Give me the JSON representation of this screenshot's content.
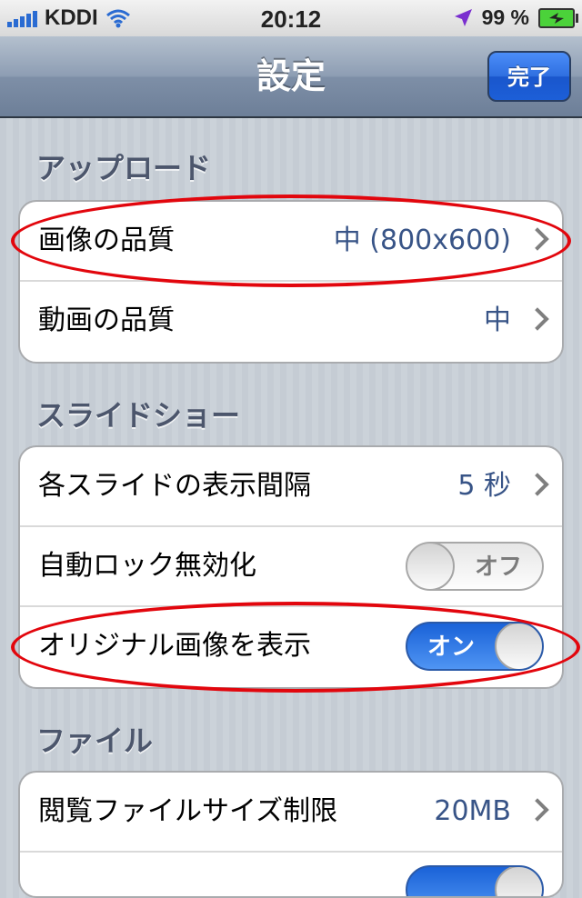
{
  "status_bar": {
    "carrier": "KDDI",
    "time": "20:12",
    "battery": "99 %",
    "battery_level": 0.99
  },
  "nav": {
    "title": "設定",
    "done_label": "完了"
  },
  "sections": [
    {
      "title": "アップロード",
      "rows": [
        {
          "label": "画像の品質",
          "value": "中 (800x600)"
        },
        {
          "label": "動画の品質",
          "value": "中"
        }
      ]
    },
    {
      "title": "スライドショー",
      "rows": [
        {
          "label": "各スライドの表示間隔",
          "value": "5 秒"
        },
        {
          "label": "自動ロック無効化",
          "toggle": "オフ"
        },
        {
          "label": "オリジナル画像を表示",
          "toggle": "オン"
        }
      ]
    },
    {
      "title": "ファイル",
      "rows": [
        {
          "label": "閲覧ファイルサイズ制限",
          "value": "20MB"
        }
      ]
    }
  ],
  "colors": {
    "accent_blue": "#1c5fd8",
    "value_text": "#385487",
    "annotation_red": "#e2060d"
  }
}
